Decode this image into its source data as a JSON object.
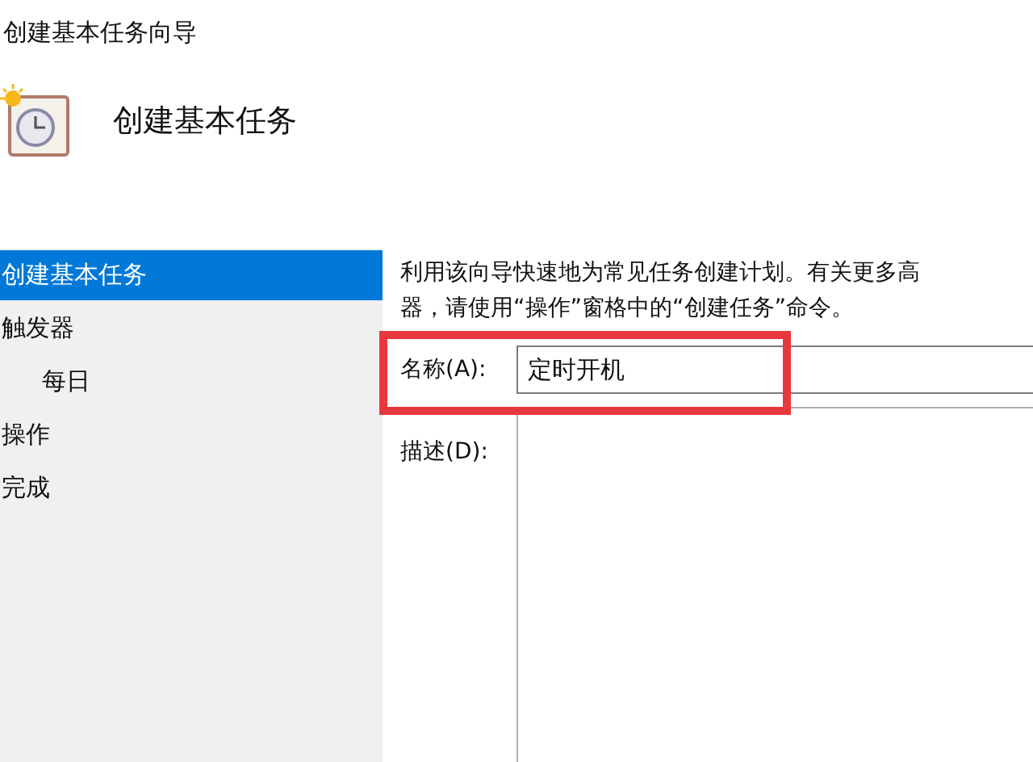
{
  "window": {
    "title": "创建基本任务向导"
  },
  "header": {
    "title": "创建基本任务"
  },
  "sidebar": {
    "items": [
      {
        "label": "创建基本任务",
        "selected": true
      },
      {
        "label": "触发器",
        "selected": false,
        "children": [
          {
            "label": "每日",
            "selected": false
          }
        ]
      },
      {
        "label": "操作",
        "selected": false
      },
      {
        "label": "完成",
        "selected": false
      }
    ]
  },
  "intro": [
    "利用该向导快速地为常见任务创建计划。有关更多高",
    "器，请使用“操作”窗格中的“创建任务”命令。"
  ],
  "name_field": {
    "label": "名称(A):",
    "value": "定时开机",
    "highlighted": true
  },
  "description_field": {
    "label": "描述(D):"
  }
}
